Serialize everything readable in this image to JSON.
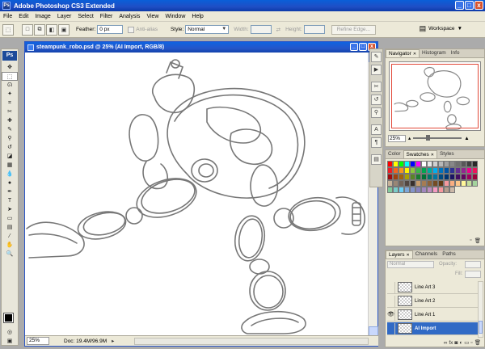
{
  "app": {
    "title": "Adobe Photoshop CS3 Extended",
    "icon": "Ps"
  },
  "window_buttons": [
    "_",
    "□",
    "x"
  ],
  "menu": [
    "File",
    "Edit",
    "Image",
    "Layer",
    "Select",
    "Filter",
    "Analysis",
    "View",
    "Window",
    "Help"
  ],
  "options": {
    "feather_label": "Feather:",
    "feather_value": "0 px",
    "antialias_label": "Anti-alias",
    "style_label": "Style:",
    "style_value": "Normal",
    "width_label": "Width:",
    "height_label": "Height:",
    "refine_label": "Refine Edge...",
    "workspace_label": "Workspace"
  },
  "toolbox": {
    "logo": "Ps"
  },
  "document": {
    "title": "steampunk_robo.psd @ 25% (AI Import, RGB/8)",
    "zoom": "25%",
    "doc_info": "Doc: 19.4M/96.9M"
  },
  "navigator": {
    "tabs": [
      "Navigator",
      "Histogram",
      "Info"
    ],
    "zoom": "25%"
  },
  "swatches_panel": {
    "tabs": [
      "Color",
      "Swatches",
      "Styles"
    ],
    "colors": [
      "#ff0000",
      "#ffff00",
      "#00ff00",
      "#00ffff",
      "#0000ff",
      "#ff00ff",
      "#ffffff",
      "#e8e8e8",
      "#d0d0d0",
      "#b8b8b8",
      "#a0a0a0",
      "#888888",
      "#707070",
      "#585858",
      "#404040",
      "#282828",
      "#ee1c24",
      "#f26522",
      "#f7941d",
      "#fff200",
      "#8dc63f",
      "#39b54a",
      "#00a651",
      "#00a99d",
      "#00aeef",
      "#0072bc",
      "#0054a6",
      "#2e3192",
      "#662d91",
      "#92278f",
      "#ec008c",
      "#ed145b",
      "#9e0b0f",
      "#a0410d",
      "#a36209",
      "#aba000",
      "#598527",
      "#197b30",
      "#007236",
      "#00746b",
      "#0076a3",
      "#004a80",
      "#003471",
      "#1b1464",
      "#440e62",
      "#630460",
      "#9e005d",
      "#9e0039",
      "#c7b299",
      "#998675",
      "#736357",
      "#534741",
      "#37302d",
      "#c69c6d",
      "#a67c52",
      "#8c6239",
      "#754c24",
      "#603913",
      "#f5989d",
      "#f9ad81",
      "#fdc68a",
      "#fff799",
      "#c4df9b",
      "#a3d39c",
      "#82ca9c",
      "#7accc8",
      "#6dcff6",
      "#7da7d9",
      "#8393ca",
      "#8781bd",
      "#a187be",
      "#bd8cbf",
      "#f49ac1",
      "#f6989d",
      "#b49c8c",
      "#cbb8a8"
    ]
  },
  "layers": {
    "tabs": [
      "Layers",
      "Channels",
      "Paths"
    ],
    "blend_mode": "Normal",
    "opacity_label": "Opacity:",
    "fill_label": "Fill:",
    "rows": [
      {
        "name": "Line Art 3",
        "visible": false,
        "selected": false
      },
      {
        "name": "Line Art 2",
        "visible": false,
        "selected": false
      },
      {
        "name": "Line Art 1",
        "visible": true,
        "selected": false
      },
      {
        "name": "AI Import",
        "visible": false,
        "selected": true
      }
    ]
  },
  "colors": {
    "titlebar": "#1f4ec5",
    "selection": "#316ac5",
    "navigator_frame": "#e24a3a"
  }
}
